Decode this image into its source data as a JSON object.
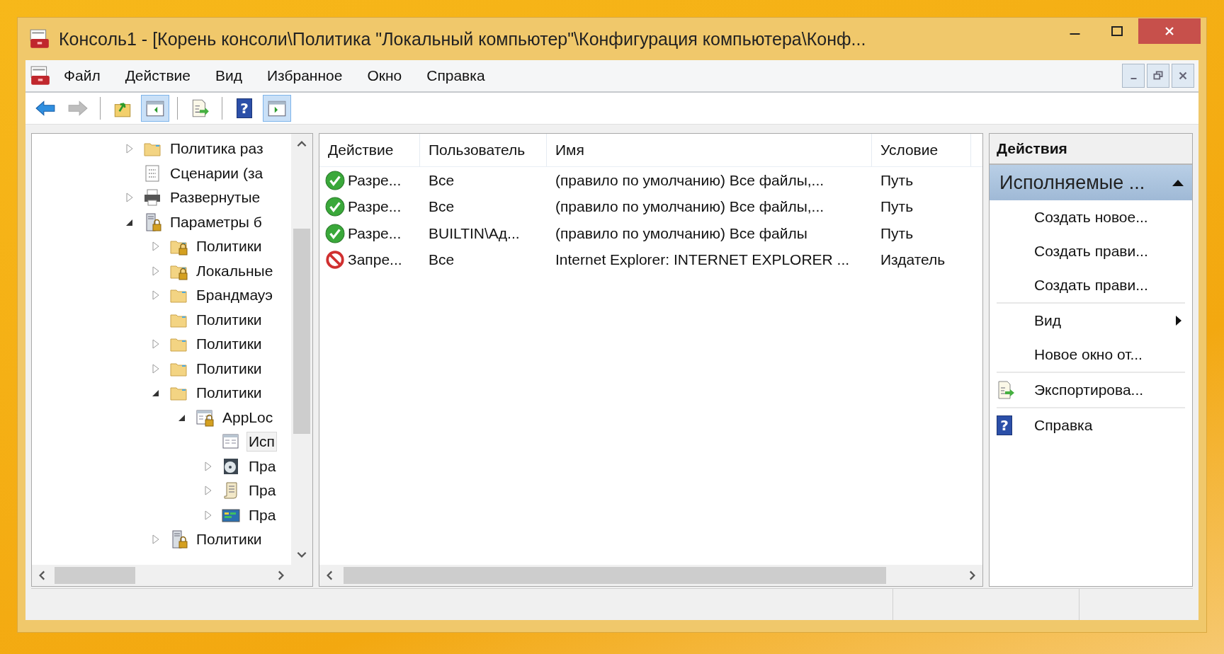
{
  "window": {
    "title": "Консоль1 - [Корень консоли\\Политика \"Локальный компьютер\"\\Конфигурация компьютера\\Конф..."
  },
  "menu": [
    "Файл",
    "Действие",
    "Вид",
    "Избранное",
    "Окно",
    "Справка"
  ],
  "toolbar": [
    [
      {
        "kind": "back",
        "pressed": false,
        "disabled": false
      },
      {
        "kind": "forward",
        "pressed": false,
        "disabled": true
      }
    ],
    [
      {
        "kind": "up",
        "pressed": false,
        "disabled": false
      },
      {
        "kind": "tree",
        "pressed": true,
        "disabled": false
      }
    ],
    [
      {
        "kind": "export",
        "pressed": false,
        "disabled": false
      }
    ],
    [
      {
        "kind": "help",
        "glyph": "?",
        "pressed": false,
        "disabled": false
      },
      {
        "kind": "pane",
        "pressed": true,
        "disabled": false
      }
    ]
  ],
  "tree": {
    "items": [
      {
        "label": "Политика раз",
        "kind": "folder",
        "expanded": false,
        "selected": false
      },
      {
        "label": "Сценарии (за",
        "kind": "script",
        "selected": false
      },
      {
        "label": "Развернутые",
        "kind": "printer",
        "expanded": false,
        "selected": false
      },
      {
        "label": "Параметры б",
        "kind": "server-lock",
        "expanded": true,
        "selected": false,
        "children": [
          {
            "label": "Политики",
            "kind": "folder-lock",
            "expanded": false,
            "selected": false
          },
          {
            "label": "Локальные",
            "kind": "folder-lock",
            "expanded": false,
            "selected": false
          },
          {
            "label": "Брандмауэ",
            "kind": "folder",
            "expanded": false,
            "selected": false
          },
          {
            "label": "Политики",
            "kind": "folder",
            "selected": false
          },
          {
            "label": "Политики",
            "kind": "folder",
            "expanded": false,
            "selected": false
          },
          {
            "label": "Политики",
            "kind": "folder",
            "expanded": false,
            "selected": false
          },
          {
            "label": "Политики",
            "kind": "folder",
            "expanded": true,
            "selected": false,
            "children": [
              {
                "label": "AppLoc",
                "kind": "window-lock",
                "expanded": true,
                "selected": false,
                "children": [
                  {
                    "label": "Исп",
                    "kind": "window",
                    "selected": true
                  },
                  {
                    "label": "Пра",
                    "kind": "disc",
                    "expanded": false,
                    "selected": false
                  },
                  {
                    "label": "Пра",
                    "kind": "scroll",
                    "expanded": false,
                    "selected": false
                  },
                  {
                    "label": "Пра",
                    "kind": "app",
                    "expanded": false,
                    "selected": false
                  }
                ]
              }
            ]
          },
          {
            "label": "Политики",
            "kind": "computer-lock",
            "expanded": false,
            "selected": false
          }
        ]
      }
    ]
  },
  "table": {
    "columns": [
      "Действие",
      "Пользователь",
      "Имя",
      "Условие",
      ""
    ],
    "rows": [
      {
        "kind": "allow",
        "action": "Разре...",
        "user": "Все",
        "name": "(правило по умолчанию) Все файлы,...",
        "condition": "Путь"
      },
      {
        "kind": "allow",
        "action": "Разре...",
        "user": "Все",
        "name": "(правило по умолчанию) Все файлы,...",
        "condition": "Путь"
      },
      {
        "kind": "allow",
        "action": "Разре...",
        "user": "BUILTIN\\Ад...",
        "name": "(правило по умолчанию) Все файлы",
        "condition": "Путь"
      },
      {
        "kind": "deny",
        "action": "Запре...",
        "user": "Все",
        "name": "Internet Explorer: INTERNET EXPLORER ...",
        "condition": "Издатель"
      }
    ]
  },
  "actions": {
    "title": "Действия",
    "section": {
      "label": "Исполняемые ...",
      "expanded": true
    },
    "items": [
      {
        "kind": "item",
        "label": "Создать новое..."
      },
      {
        "kind": "item",
        "label": "Создать прави..."
      },
      {
        "kind": "item",
        "label": "Создать прави..."
      },
      {
        "kind": "separator"
      },
      {
        "kind": "submenu",
        "label": "Вид"
      },
      {
        "kind": "item",
        "label": "Новое окно от..."
      },
      {
        "kind": "separator"
      },
      {
        "kind": "export",
        "label": "Экспортирова..."
      },
      {
        "kind": "separator"
      },
      {
        "kind": "help",
        "label": "Справка",
        "glyph": "?"
      }
    ]
  }
}
